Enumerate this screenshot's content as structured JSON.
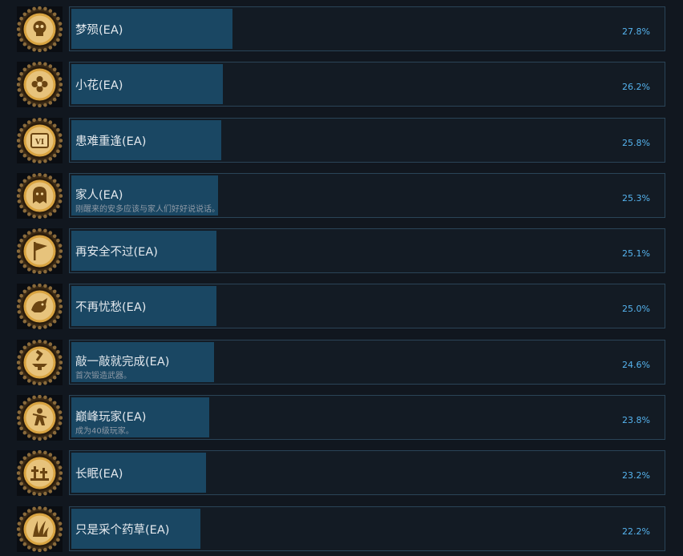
{
  "achievements": [
    {
      "title": "梦殒(EA)",
      "description": "",
      "percent": "27.8%",
      "percent_value": 27.8,
      "icon": "skull-medallion-icon"
    },
    {
      "title": "小花(EA)",
      "description": "",
      "percent": "26.2%",
      "percent_value": 26.2,
      "icon": "flower-medallion-icon"
    },
    {
      "title": "患难重逢(EA)",
      "description": "",
      "percent": "25.8%",
      "percent_value": 25.8,
      "icon": "scroll-vi-medallion-icon"
    },
    {
      "title": "家人(EA)",
      "description": "刚醒来的安多应该与家人们好好说说话。",
      "percent": "25.3%",
      "percent_value": 25.3,
      "icon": "ghost-medallion-icon"
    },
    {
      "title": "再安全不过(EA)",
      "description": "",
      "percent": "25.1%",
      "percent_value": 25.1,
      "icon": "flag-medallion-icon"
    },
    {
      "title": "不再忧愁(EA)",
      "description": "",
      "percent": "25.0%",
      "percent_value": 25.0,
      "icon": "beast-medallion-icon"
    },
    {
      "title": "敲一敲就完成(EA)",
      "description": "首次锻造武器。",
      "percent": "24.6%",
      "percent_value": 24.6,
      "icon": "anvil-medallion-icon"
    },
    {
      "title": "巅峰玩家(EA)",
      "description": "成为40级玩家。",
      "percent": "23.8%",
      "percent_value": 23.8,
      "icon": "figure-medallion-icon"
    },
    {
      "title": "长眠(EA)",
      "description": "",
      "percent": "23.2%",
      "percent_value": 23.2,
      "icon": "graves-medallion-icon"
    },
    {
      "title": "只是采个药草(EA)",
      "description": "",
      "percent": "22.2%",
      "percent_value": 22.2,
      "icon": "herb-medallion-icon"
    }
  ],
  "colors": {
    "background": "#11171f",
    "bar_fill": "#1a4763",
    "bar_border": "#2a4457",
    "percent_text": "#56b4ef",
    "medallion_gold": "#d9a441"
  }
}
